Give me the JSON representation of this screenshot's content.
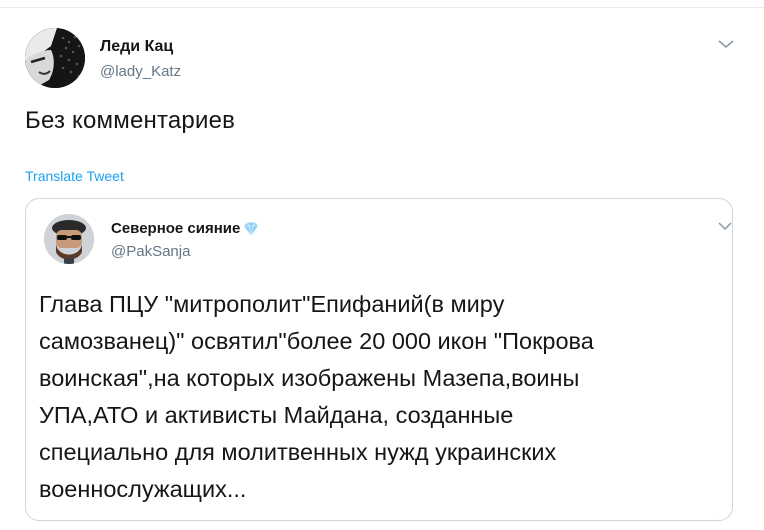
{
  "tweet": {
    "author_name": "Леди Кац",
    "author_handle": "@lady_Katz",
    "text": "Без комментариев",
    "translate_label": "Translate Tweet",
    "more_icon": "chevron-down-icon"
  },
  "quoted_tweet": {
    "author_name": "Северное сияние",
    "author_handle": "@PakSanja",
    "badge_icon": "diamond-icon",
    "text": "Глава ПЦУ \"митрополит\"Епифаний(в миру\nсамозванец)\" освятил\"более 20 000 икон \"Покрова\nвоинская\",на которых изображены Мазепа,воины\nУПА,АТО и активисты Майдана, созданные\nспециально для молитвенных нужд украинских\nвоеннослужащих...",
    "more_icon": "chevron-down-icon"
  },
  "colors": {
    "link": "#1da1f2",
    "secondary_text": "#657786",
    "border": "#ccd6dd",
    "diamond": "#8ecdf7"
  }
}
